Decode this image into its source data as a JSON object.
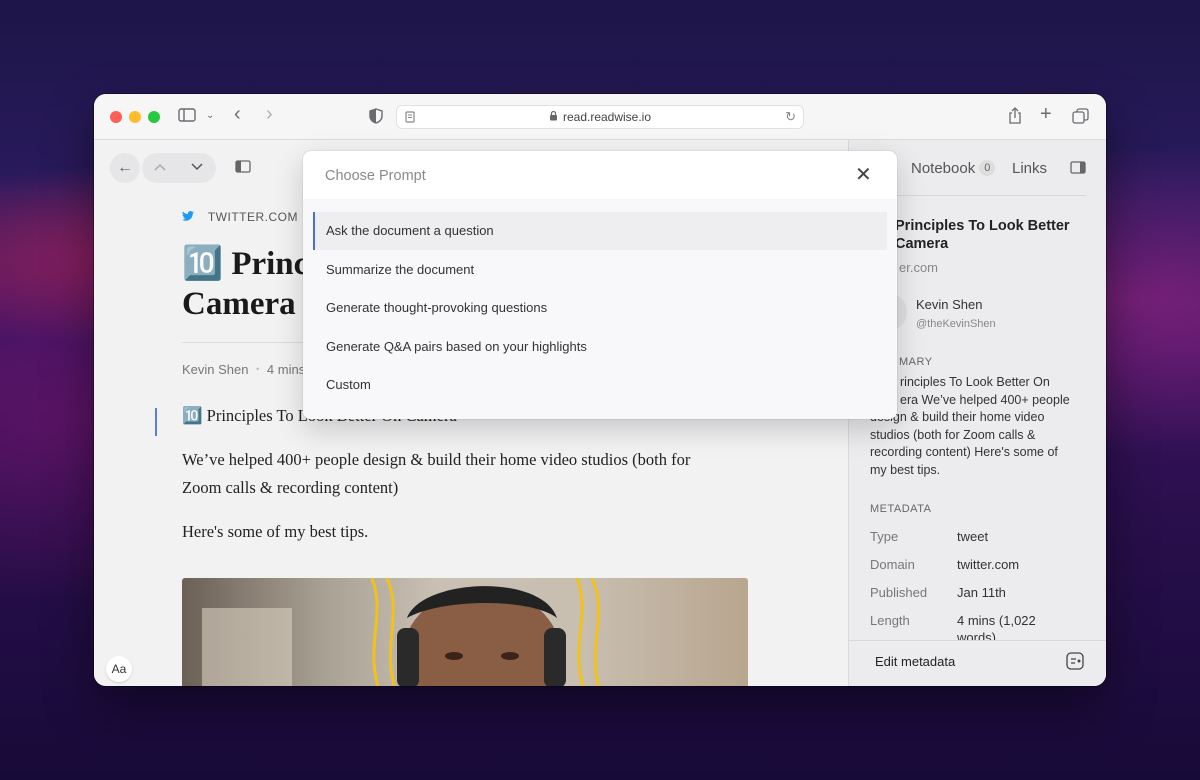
{
  "browser": {
    "url": "read.readwise.io"
  },
  "reader": {
    "source": "TWITTER.COM",
    "title_line1": "🔟 Princi",
    "title_line2": "Camera",
    "byline_author": "Kevin Shen",
    "byline_sep": "•",
    "byline_read": "4 mins",
    "paragraph1": "🔟 Principles To Look Better On Camera",
    "paragraph2a": "We’ve helped 400+ people design & build their home video studios (both for",
    "paragraph2b": "Zoom calls & recording content)",
    "paragraph3": "Here's some of my best tips.",
    "aa_label": "Aa"
  },
  "sidebar": {
    "tab_notebook": "Notebook",
    "notebook_count": "0",
    "tab_links": "Links",
    "title_line1": "Principles To Look Better",
    "title_line2": "Camera",
    "domain_partial": "er.com",
    "author_name": "Kevin Shen",
    "author_handle": "@theKevinShen",
    "summary_heading": "MARY",
    "summary_lines": [
      "rinciples To Look Better On",
      "era We’ve helped 400+ people",
      "design & build their home video",
      "studios (both for Zoom calls &",
      "recording content) Here's some of",
      "my best tips."
    ],
    "metadata_heading": "METADATA",
    "meta": [
      {
        "label": "Type",
        "value": "tweet"
      },
      {
        "label": "Domain",
        "value": "twitter.com"
      },
      {
        "label": "Published",
        "value": "Jan 11th"
      },
      {
        "label": "Length",
        "value": "4 mins (1,022"
      }
    ],
    "length_cont": "words)",
    "edit_metadata": "Edit metadata"
  },
  "modal": {
    "title": "Choose Prompt",
    "close": "✕",
    "options": [
      "Ask the document a question",
      "Summarize the document",
      "Generate thought-provoking questions",
      "Generate Q&A pairs based on your highlights",
      "Custom"
    ],
    "selected_index": 0
  }
}
